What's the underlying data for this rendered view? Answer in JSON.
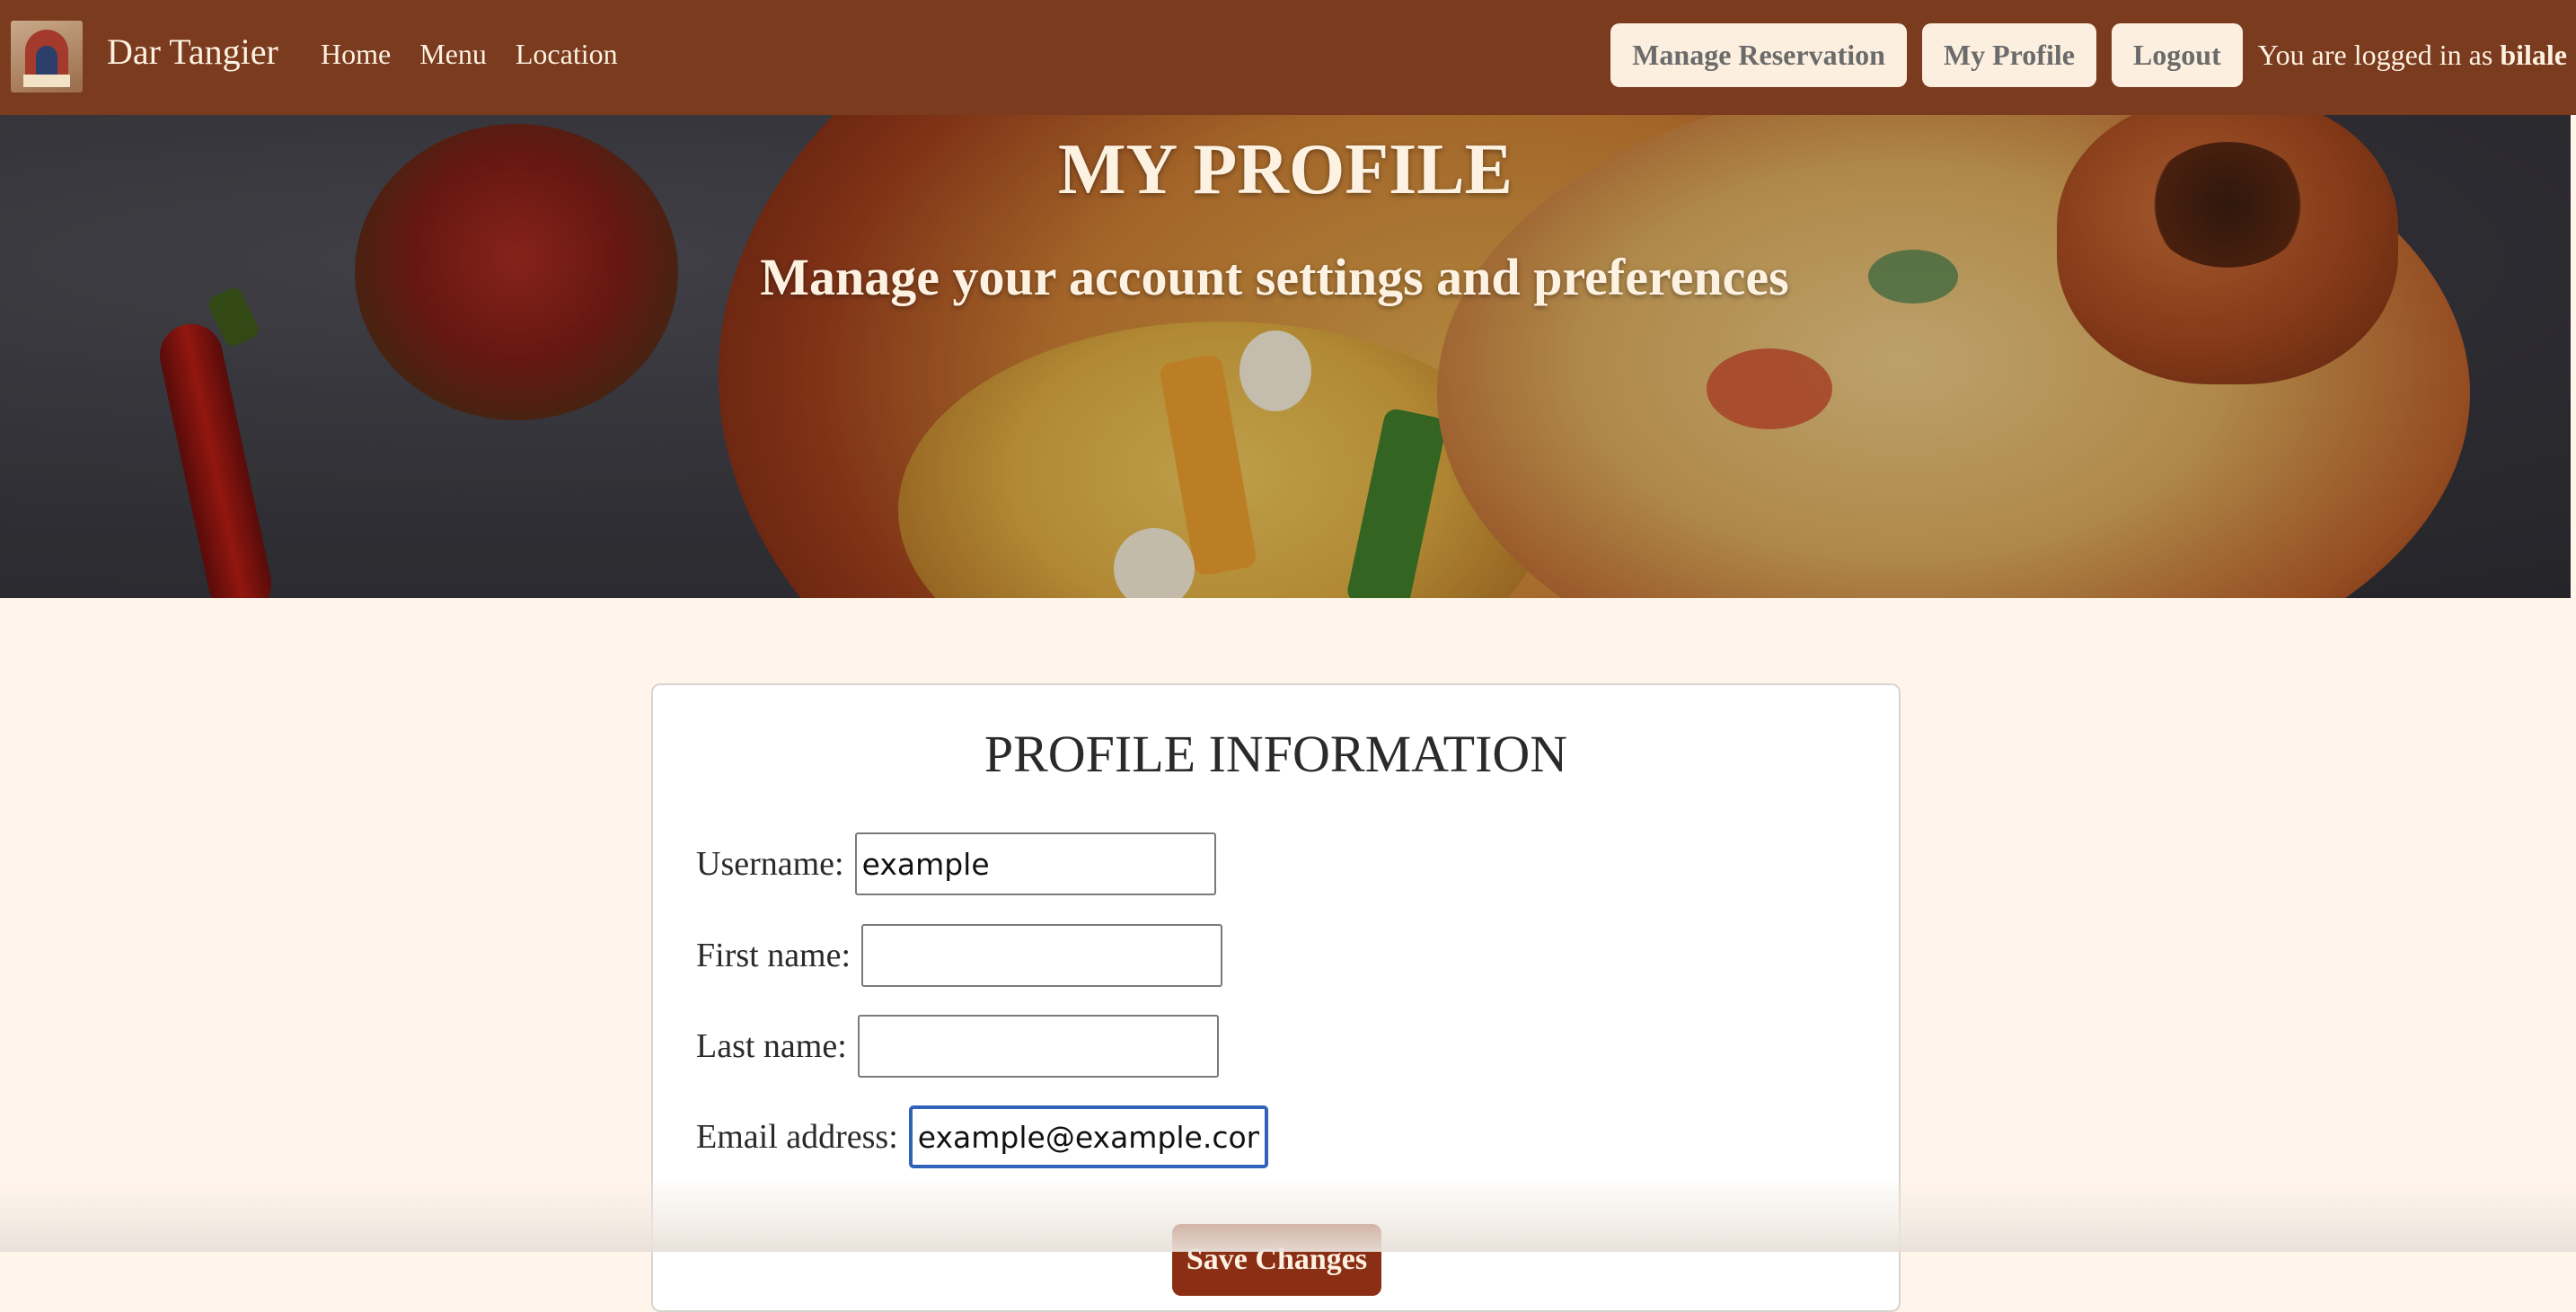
{
  "navbar": {
    "brand": "Dar Tangier",
    "links": [
      "Home",
      "Menu",
      "Location"
    ],
    "buttons": [
      "Manage Reservation",
      "My Profile",
      "Logout"
    ],
    "logged_in_prefix": "You are logged in as ",
    "username": "bilale"
  },
  "hero": {
    "title": "MY PROFILE",
    "subtitle": "Manage your account settings and preferences"
  },
  "profile_form": {
    "title": "PROFILE INFORMATION",
    "fields": [
      {
        "label": "Username:",
        "value": "example"
      },
      {
        "label": "First name:",
        "value": ""
      },
      {
        "label": "Last name:",
        "value": ""
      },
      {
        "label": "Email address:",
        "value": "example@example.com"
      }
    ],
    "submit_label": "Save Changes"
  },
  "colors": {
    "navbar_bg": "#7a3b1e",
    "page_bg": "#fff5eb",
    "button_bg": "#fcefdf",
    "accent": "#8a2f14",
    "focus_ring": "#2f62b8"
  }
}
